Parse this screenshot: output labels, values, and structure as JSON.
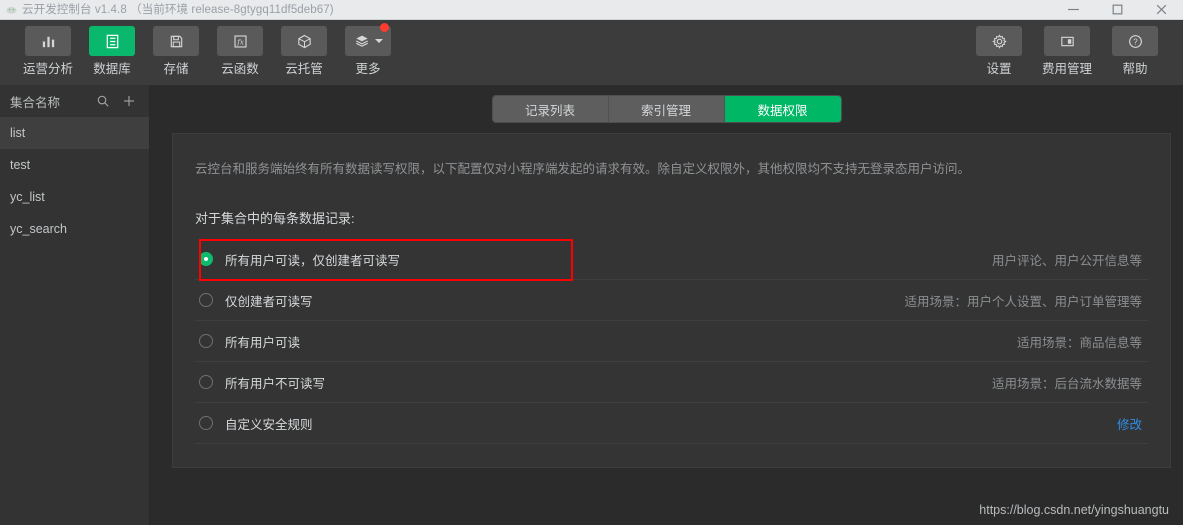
{
  "window": {
    "title": "云开发控制台 v1.4.8 （当前环境 release-8gtygq11df5deb67)",
    "logo_icon": "cloud-logo-icon",
    "minimize_label": "最小化",
    "maximize_label": "最大化",
    "close_label": "关闭"
  },
  "toolbar": {
    "left_items": [
      {
        "label": "运营分析",
        "icon": "bar-chart-icon",
        "active": false,
        "badge": false,
        "caret": false
      },
      {
        "label": "数据库",
        "icon": "database-icon",
        "active": true,
        "badge": false,
        "caret": false
      },
      {
        "label": "存储",
        "icon": "save-disk-icon",
        "active": false,
        "badge": false,
        "caret": false
      },
      {
        "label": "云函数",
        "icon": "function-fx-icon",
        "active": false,
        "badge": false,
        "caret": false
      },
      {
        "label": "云托管",
        "icon": "cube-icon",
        "active": false,
        "badge": false,
        "caret": false
      },
      {
        "label": "更多",
        "icon": "layers-icon",
        "active": false,
        "badge": true,
        "caret": true
      }
    ],
    "right_items": [
      {
        "label": "设置",
        "icon": "gear-icon"
      },
      {
        "label": "费用管理",
        "icon": "panel-window-icon"
      },
      {
        "label": "帮助",
        "icon": "question-circle-icon"
      }
    ]
  },
  "sidebar": {
    "title": "集合名称",
    "search_icon": "search-icon",
    "add_icon": "plus-icon",
    "items": [
      {
        "label": "list",
        "selected": true
      },
      {
        "label": "test",
        "selected": false
      },
      {
        "label": "yc_list",
        "selected": false
      },
      {
        "label": "yc_search",
        "selected": false
      }
    ]
  },
  "main": {
    "tabs": [
      {
        "label": "记录列表",
        "active": false
      },
      {
        "label": "索引管理",
        "active": false
      },
      {
        "label": "数据权限",
        "active": true
      }
    ],
    "description": "云控台和服务端始终有所有数据读写权限，以下配置仅对小程序端发起的请求有效。除自定义权限外，其他权限均不支持无登录态用户访问。",
    "heading": "对于集合中的每条数据记录:",
    "options": [
      {
        "label": "所有用户可读，仅创建者可读写",
        "hint": "用户评论、用户公开信息等",
        "selected": true,
        "link": "",
        "highlighted": true
      },
      {
        "label": "仅创建者可读写",
        "hint": "适用场景：用户个人设置、用户订单管理等",
        "selected": false,
        "link": "",
        "highlighted": false
      },
      {
        "label": "所有用户可读",
        "hint": "适用场景：商品信息等",
        "selected": false,
        "link": "",
        "highlighted": false
      },
      {
        "label": "所有用户不可读写",
        "hint": "适用场景：后台流水数据等",
        "selected": false,
        "link": "",
        "highlighted": false
      },
      {
        "label": "自定义安全规则",
        "hint": "",
        "selected": false,
        "link": "修改",
        "highlighted": false
      }
    ]
  },
  "watermark": "https://blog.csdn.net/yingshuangtu",
  "colors": {
    "accent_green": "#09b86d",
    "tab_active_green": "#00b766",
    "annotation_red": "#ff0000",
    "link_blue": "#2f8fe6",
    "badge_red": "#ff3b30"
  }
}
